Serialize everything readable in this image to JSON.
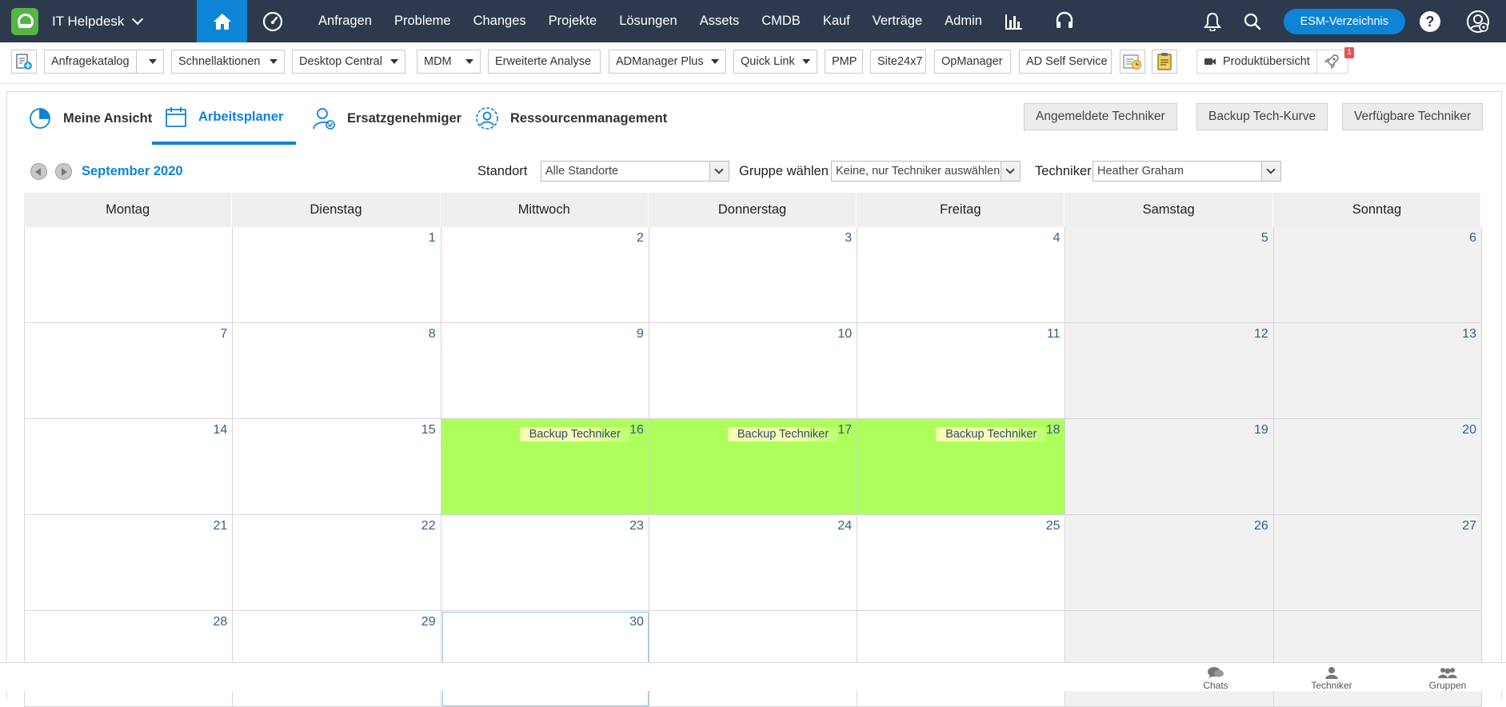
{
  "topnav": {
    "app_title": "IT Helpdesk",
    "items": [
      "Anfragen",
      "Probleme",
      "Changes",
      "Projekte",
      "Lösungen",
      "Assets",
      "CMDB",
      "Kauf",
      "Verträge",
      "Admin"
    ],
    "esm_button": "ESM-Verzeichnis",
    "help_label": "?"
  },
  "toolbar": {
    "anfragekatalog": "Anfragekatalog",
    "schnellaktionen": "Schnellaktionen",
    "desktop_central": "Desktop Central",
    "mdm": "MDM",
    "erweiterte_analyse": "Erweiterte Analyse",
    "admanager_plus": "ADManager Plus",
    "quick_link": "Quick Link",
    "pmp": "PMP",
    "site24x7": "Site24x7",
    "opmanager": "OpManager",
    "ad_self_service": "AD Self Service",
    "produktuebersicht": "Produktübersicht",
    "rocket_badge": "1"
  },
  "tabs": {
    "meine_ansicht": "Meine Ansicht",
    "arbeitsplaner": "Arbeitsplaner",
    "ersatzgenehmiger": "Ersatzgenehmiger",
    "ressourcenmanagement": "Ressourcenmanagement"
  },
  "actions": {
    "angemeldete": "Angemeldete Techniker",
    "backup_kurve": "Backup Tech-Kurve",
    "verfuegbare": "Verfügbare Techniker"
  },
  "filters": {
    "month": "September 2020",
    "standort_label": "Standort",
    "standort_value": "Alle Standorte",
    "gruppe_label": "Gruppe wählen",
    "gruppe_value": "Keine, nur Techniker auswählen",
    "techniker_label": "Techniker",
    "techniker_value": "Heather Graham"
  },
  "calendar": {
    "weekdays": [
      "Montag",
      "Dienstag",
      "Mittwoch",
      "Donnerstag",
      "Freitag",
      "Samstag",
      "Sonntag"
    ],
    "days": [
      "",
      "1",
      "2",
      "3",
      "4",
      "5",
      "6",
      "7",
      "8",
      "9",
      "10",
      "11",
      "12",
      "13",
      "14",
      "15",
      "16",
      "17",
      "18",
      "19",
      "20",
      "21",
      "22",
      "23",
      "24",
      "25",
      "26",
      "27",
      "28",
      "29",
      "30",
      "",
      "",
      "",
      ""
    ],
    "event_label": "Backup Techniker",
    "highlight_color": "#adff5c"
  },
  "bottombar": {
    "chats": "Chats",
    "techniker": "Techniker",
    "gruppen": "Gruppen"
  }
}
